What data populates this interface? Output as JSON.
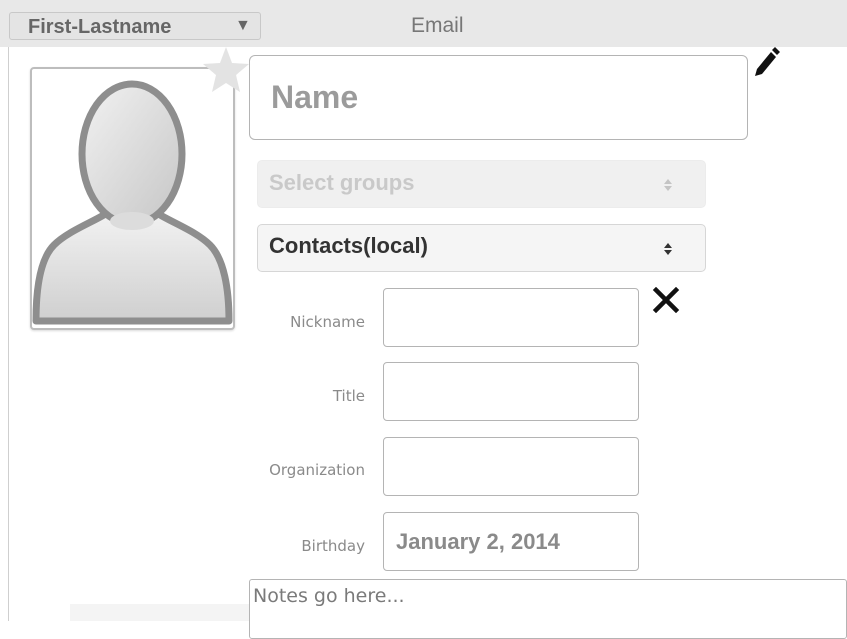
{
  "header": {
    "sort_select": {
      "value": "First-Lastname",
      "arrow_icon": "triangle-down-icon"
    },
    "email_column": "Email"
  },
  "contact": {
    "avatar_icon": "person-silhouette-icon",
    "favorite_icon": "star-icon",
    "edit_icon": "pencil-icon",
    "name": {
      "value": "",
      "placeholder": "Name"
    },
    "groups_select": {
      "placeholder": "Select groups"
    },
    "addressbook_select": {
      "value": "Contacts(local)"
    },
    "delete_icon": "x-icon",
    "fields": {
      "nickname": {
        "label": "Nickname",
        "value": ""
      },
      "title": {
        "label": "Title",
        "value": ""
      },
      "organization": {
        "label": "Organization",
        "value": ""
      },
      "birthday": {
        "label": "Birthday",
        "value": "January 2, 2014"
      }
    },
    "notes": {
      "value": "",
      "placeholder": "Notes go here..."
    }
  },
  "colors": {
    "header_bg": "#e8e8e8",
    "border": "#b4b4b4",
    "label_text": "#8a8a8a",
    "placeholder_text": "#9b9b9b"
  }
}
